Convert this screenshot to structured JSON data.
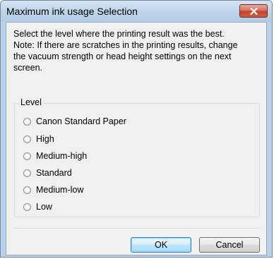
{
  "window": {
    "title": "Maximum ink usage Selection"
  },
  "message": {
    "lines": [
      "Select the level where the printing result was the best.",
      "Note: If there are scratches in the printing results, change",
      "the vacuum strength or head height settings on the next",
      "screen."
    ]
  },
  "level_group": {
    "label": "Level",
    "options": [
      {
        "label": "Canon Standard Paper",
        "selected": false
      },
      {
        "label": "High",
        "selected": false
      },
      {
        "label": "Medium-high",
        "selected": false
      },
      {
        "label": "Standard",
        "selected": false
      },
      {
        "label": "Medium-low",
        "selected": false
      },
      {
        "label": "Low",
        "selected": false
      }
    ]
  },
  "buttons": {
    "ok": "OK",
    "cancel": "Cancel"
  },
  "colors": {
    "titlebar": "#c0d5ec",
    "client_background": "#f0f0f0",
    "close_button": "#c3442b",
    "default_button_border": "#3c7fb1"
  },
  "icons": {
    "close": "close-icon"
  }
}
